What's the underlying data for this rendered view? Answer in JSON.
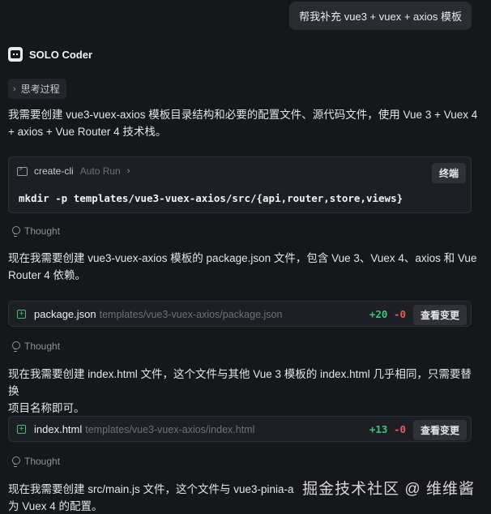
{
  "user_message": "帮我补充 vue3 + vuex + axios 模板",
  "agent": {
    "name": "SOLO Coder"
  },
  "thinking_chip": {
    "label": "思考过程"
  },
  "paragraphs": {
    "p1_line1": "我需要创建 vue3-vuex-axios 模板目录结构和必要的配置文件、源代码文件，使用 Vue 3 + Vuex 4",
    "p1_line2": "+ axios + Vue Router 4 技术栈。",
    "p2_line1": "现在我需要创建 vue3-vuex-axios 模板的 package.json 文件，包含 Vue 3、Vuex 4、axios 和 Vue",
    "p2_line2": "Router 4 依赖。",
    "p3_line1": "现在我需要创建 index.html 文件，这个文件与其他 Vue 3 模板的 index.html 几乎相同，只需要替换",
    "p3_line2": "项目名称即可。",
    "p4_line1": "现在我需要创建 src/main.js 文件，这个文件与 vue3-pinia-a",
    "p4_line2": "为 Vuex 4 的配置。"
  },
  "terminal": {
    "name": "create-cli",
    "mode": "Auto Run",
    "button": "终端",
    "command": "mkdir -p templates/vue3-vuex-axios/src/{api,router,store,views}"
  },
  "thought_label": "Thought",
  "files": [
    {
      "name": "package.json",
      "path": "templates/vue3-vuex-axios/package.json",
      "added": "+20",
      "removed": "-0",
      "button": "查看变更"
    },
    {
      "name": "index.html",
      "path": "templates/vue3-vuex-axios/index.html",
      "added": "+13",
      "removed": "-0",
      "button": "查看变更"
    }
  ],
  "watermark": "掘金技术社区 @ 维维酱",
  "colors": {
    "background": "#16171b",
    "added": "#3ec27a",
    "removed": "#e35d5d"
  }
}
